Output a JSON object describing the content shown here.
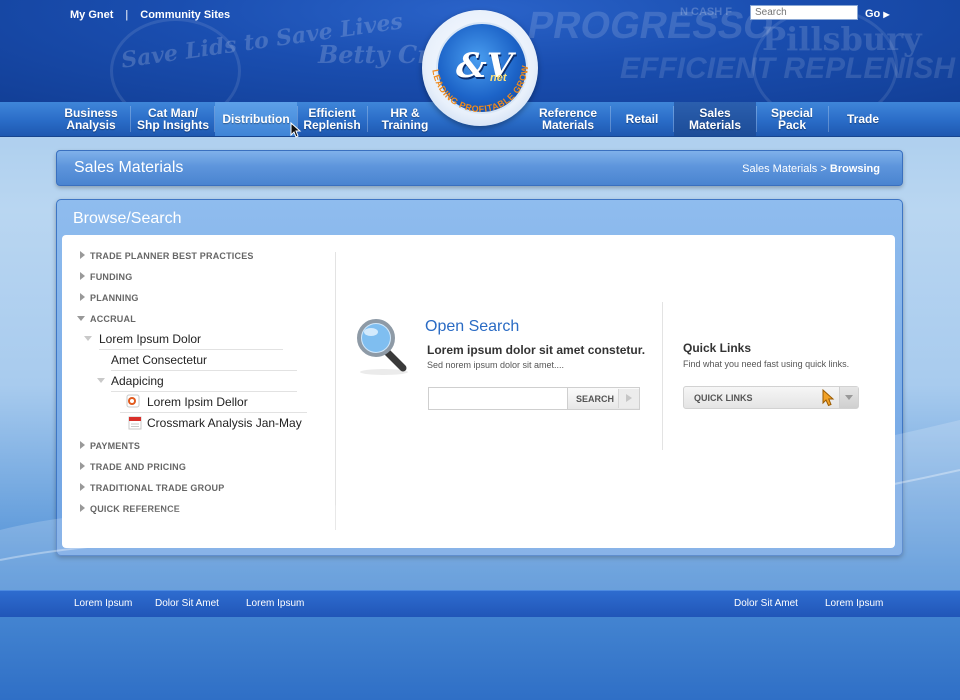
{
  "header": {
    "top_links": [
      "My Gnet",
      "Community Sites"
    ],
    "top_separator": "|",
    "search_placeholder": "Search",
    "go_label": "Go",
    "logo": {
      "mark": "&V",
      "suffix": "net",
      "ring_text": "LEADING PROFITABLE GROWTH"
    },
    "background_brands": [
      "Save Lids to Save Lives",
      "Betty Crocker",
      "PROGRESSO",
      "EFFICIENT REPLENISH",
      "Pillsbury",
      "N CASH F"
    ]
  },
  "nav": {
    "items": [
      {
        "label_line1": "Business",
        "label_line2": "Analysis"
      },
      {
        "label_line1": "Cat Man/",
        "label_line2": "Shp Insights"
      },
      {
        "label_line1": "Distribution",
        "label_line2": ""
      },
      {
        "label_line1": "Efficient",
        "label_line2": "Replenish"
      },
      {
        "label_line1": "HR &",
        "label_line2": "Training"
      },
      {
        "label_line1": "Reference",
        "label_line2": "Materials"
      },
      {
        "label_line1": "Retail",
        "label_line2": ""
      },
      {
        "label_line1": "Sales",
        "label_line2": "Materials"
      },
      {
        "label_line1": "Special",
        "label_line2": "Pack"
      },
      {
        "label_line1": "Trade",
        "label_line2": ""
      }
    ],
    "hovered": "Distribution",
    "selected": "Sales Materials"
  },
  "page": {
    "title": "Sales Materials",
    "breadcrumb_parent": "Sales Materials",
    "breadcrumb_separator": ">",
    "breadcrumb_current": "Browsing"
  },
  "browse": {
    "title": "Browse/Search",
    "categories_top": [
      "TRADE PLANNER BEST PRACTICES",
      "FUNDING",
      "PLANNING",
      "ACCRUAL"
    ],
    "accrual_children": {
      "level1": "Lorem Ipsum Dolor",
      "level2a": "Amet Consectetur",
      "level2b": "Adapicing",
      "files": [
        {
          "name": "Lorem Ipsim Dellor",
          "icon": "powerpoint-file-icon"
        },
        {
          "name": "Crossmark Analysis Jan-May",
          "icon": "calendar-file-icon"
        }
      ]
    },
    "categories_bottom": [
      "PAYMENTS",
      "TRADE AND PRICING",
      "TRADITIONAL TRADE GROUP",
      "QUICK REFERENCE"
    ]
  },
  "open_search": {
    "title": "Open Search",
    "heading": "Lorem ipsum dolor sit amet constetur.",
    "subtext": "Sed norem ipsum dolor sit amet....",
    "input_value": "",
    "button_label": "SEARCH"
  },
  "quick_links": {
    "title": "Quick Links",
    "subtext": "Find what you need fast using quick links.",
    "select_label": "QUICK LINKS"
  },
  "footer": {
    "left_links": [
      "Lorem Ipsum",
      "Dolor Sit Amet",
      "Lorem Ipsum"
    ],
    "right_links": [
      "Dolor Sit Amet",
      "Lorem Ipsum"
    ]
  },
  "colors": {
    "header_blue": "#1a4eb0",
    "nav_blue": "#2a6cc7",
    "accent_link": "#2a6bc4",
    "cursor_orange": "#f2a227"
  }
}
